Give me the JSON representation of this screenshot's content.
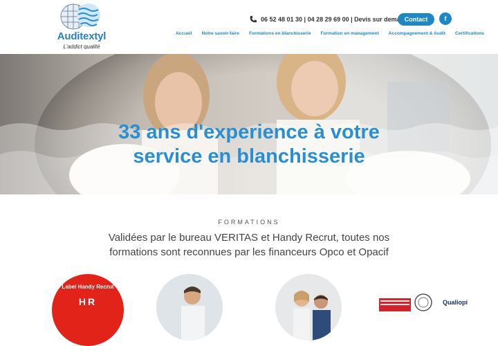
{
  "brand": {
    "name": "Auditextyl",
    "tagline": "L'addict qualité"
  },
  "topbar": {
    "phone_line": "06 52 48 01 30 | 04 28 29 69 00 | Devis sur demande",
    "contact_label": "Contact",
    "facebook_label": "f"
  },
  "nav": {
    "items": [
      "Accueil",
      "Notre savoir-faire",
      "Formations en blanchisserie",
      "Formation en management",
      "Accompagnement & Audit",
      "Certifications"
    ]
  },
  "hero": {
    "title": "33 ans d'experience à votre service en blanchisserie"
  },
  "formations": {
    "label": "FORMATIONS",
    "text": "Validées par le bureau VERITAS et Handy Recrut, toutes nos formations sont reconnues par les financeurs Opco et Opacif"
  },
  "badges": {
    "handy_top": "Label Handy Recrut",
    "handy_mark": "HR",
    "qualiopi": "Qualiopi"
  },
  "colors": {
    "accent": "#1e88c7",
    "badge_red": "#e2231a"
  }
}
